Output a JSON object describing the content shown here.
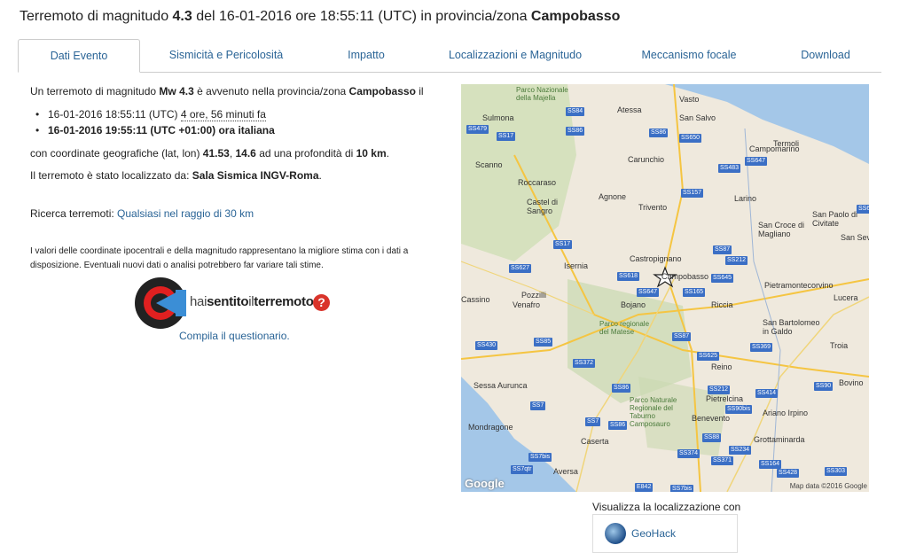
{
  "title": {
    "prefix": "Terremoto di magnitudo ",
    "mag": "4.3",
    "mid": " del 16-01-2016 ore 18:55:11 (UTC) in provincia/zona ",
    "zone": "Campobasso"
  },
  "tabs": [
    {
      "label": "Dati Evento"
    },
    {
      "label": "Sismicità e Pericolosità"
    },
    {
      "label": "Impatto"
    },
    {
      "label": "Localizzazioni e Magnitudo"
    },
    {
      "label": "Meccanismo focale"
    },
    {
      "label": "Download"
    }
  ],
  "content": {
    "p1_a": "Un terremoto di magnitudo ",
    "p1_mag": "Mw 4.3",
    "p1_b": " è avvenuto nella provincia/zona ",
    "p1_zone": "Campobasso",
    "p1_c": " il",
    "bullet1_a": "16-01-2016 18:55:11 (UTC) ",
    "bullet1_b": "4 ore, 56 minuti fa",
    "bullet2": "16-01-2016 19:55:11 (UTC +01:00) ora italiana",
    "p2_a": "con coordinate geografiche (lat, lon) ",
    "p2_lat": "41.53",
    "p2_sep": ", ",
    "p2_lon": "14.6",
    "p2_b": " ad una profondità di ",
    "p2_depth": "10 km",
    "p2_c": ".",
    "p3_a": "Il terremoto è stato localizzato da: ",
    "p3_b": "Sala Sismica INGV-Roma",
    "p3_c": ".",
    "p4_a": "Ricerca terremoti: ",
    "p4_link": "Qualsiasi nel raggio di 30 km",
    "p5": "I valori delle coordinate ipocentrali e della magnitudo rappresentano la migliore stima con i dati a disposizione. Eventuali nuovi dati o analisi potrebbero far variare tali stime.",
    "hse_a": "hai",
    "hse_b": "sentito",
    "hse_c": "il",
    "hse_d": "terremoto",
    "hse_q": "?",
    "compila": "Compila il questionario."
  },
  "map": {
    "places": [
      {
        "name": "Vasto"
      },
      {
        "name": "Termoli"
      },
      {
        "name": "Atessa"
      },
      {
        "name": "San Salvo"
      },
      {
        "name": "Sulmona"
      },
      {
        "name": "Campomarino"
      },
      {
        "name": "Scanno"
      },
      {
        "name": "Carunchio"
      },
      {
        "name": "Roccaraso"
      },
      {
        "name": "Agnone"
      },
      {
        "name": "Larino"
      },
      {
        "name": "Castel di Sangro"
      },
      {
        "name": "Trivento"
      },
      {
        "name": "San Croce di Magliano"
      },
      {
        "name": "San Paolo di Civitate"
      },
      {
        "name": "Isernia"
      },
      {
        "name": "Castropignano"
      },
      {
        "name": "San Sev"
      },
      {
        "name": "Campobasso"
      },
      {
        "name": "Pietramontecorvino"
      },
      {
        "name": "Cassino"
      },
      {
        "name": "Pozzilli"
      },
      {
        "name": "Venafro"
      },
      {
        "name": "Bojano"
      },
      {
        "name": "Riccia"
      },
      {
        "name": "Lucera"
      },
      {
        "name": "San Bartolomeo in Galdo"
      },
      {
        "name": "Troia"
      },
      {
        "name": "Reino"
      },
      {
        "name": "Sessa Aurunca"
      },
      {
        "name": "Pietrelcina"
      },
      {
        "name": "Bovino"
      },
      {
        "name": "Benevento"
      },
      {
        "name": "Ariano Irpino"
      },
      {
        "name": "Mondragone"
      },
      {
        "name": "Caserta"
      },
      {
        "name": "Grottaminarda"
      },
      {
        "name": "Aversa"
      },
      {
        "name": "Parco Nazionale della Majella"
      },
      {
        "name": "Parco regionale del Matese"
      },
      {
        "name": "Parco Naturale Regionale del Taburno Camposauro"
      }
    ],
    "roads": [
      "SS84",
      "SS479",
      "SS17",
      "SS86",
      "SS650",
      "SS647",
      "SS483",
      "SS157",
      "SS652",
      "SS86",
      "SS87",
      "SS212",
      "SS627",
      "SS618",
      "SS645",
      "SS647",
      "SS165",
      "SS17",
      "SS85",
      "SS430",
      "SS372",
      "SS87",
      "SS625",
      "SS369",
      "SS212",
      "SS414",
      "SS90",
      "SS90bis",
      "SS7",
      "SS88",
      "SS7qtr",
      "SS374",
      "SS371",
      "SS164",
      "SS303",
      "SS428",
      "SS7bis",
      "SS234",
      "SS7",
      "E842",
      "SS7bis",
      "SS86",
      "SS86"
    ],
    "logo": "Google",
    "copyright": "Map data ©2016 Google"
  },
  "geohack": {
    "label": "Visualizza la localizzazione con",
    "button": "GeoHack"
  },
  "colors": {
    "link": "#2a6496",
    "road_shield": "#3b6fc5",
    "map_land": "#efe9dd",
    "sea": "#a4c7e8"
  }
}
